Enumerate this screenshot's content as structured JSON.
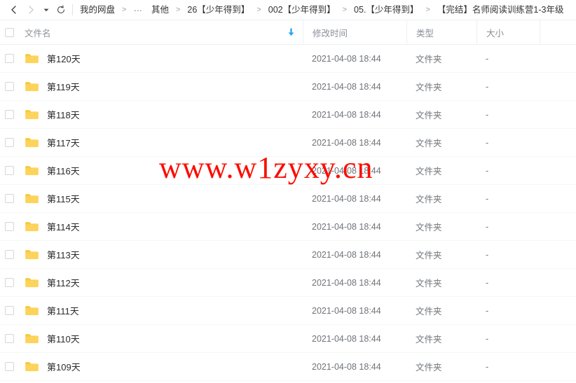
{
  "toolbar": {
    "back_label": "back-arrow",
    "forward_label": "forward-arrow",
    "caret_label": "history-dropdown",
    "refresh_label": "refresh"
  },
  "breadcrumb": {
    "separator": ">",
    "ellipsis": "…",
    "items": [
      "我的网盘",
      "…",
      "其他",
      "26【少年得到】",
      "002【少年得到】",
      "05.【少年得到】",
      "【完结】名师阅读训练营1-3年级"
    ]
  },
  "table": {
    "columns": [
      "文件名",
      "修改时间",
      "类型",
      "大小"
    ],
    "sort": {
      "column": "文件名",
      "direction": "desc",
      "icon": "arrow-down-icon",
      "color": "#2ca6f0"
    },
    "size_placeholder": "-",
    "rows": [
      {
        "name": "第120天",
        "modified": "2021-04-08 18:44",
        "type": "文件夹",
        "size": "-"
      },
      {
        "name": "第119天",
        "modified": "2021-04-08 18:44",
        "type": "文件夹",
        "size": "-"
      },
      {
        "name": "第118天",
        "modified": "2021-04-08 18:44",
        "type": "文件夹",
        "size": "-"
      },
      {
        "name": "第117天",
        "modified": "2021-04-08 18:44",
        "type": "文件夹",
        "size": "-"
      },
      {
        "name": "第116天",
        "modified": "2021-04-08 18:44",
        "type": "文件夹",
        "size": "-"
      },
      {
        "name": "第115天",
        "modified": "2021-04-08 18:44",
        "type": "文件夹",
        "size": "-"
      },
      {
        "name": "第114天",
        "modified": "2021-04-08 18:44",
        "type": "文件夹",
        "size": "-"
      },
      {
        "name": "第113天",
        "modified": "2021-04-08 18:44",
        "type": "文件夹",
        "size": "-"
      },
      {
        "name": "第112天",
        "modified": "2021-04-08 18:44",
        "type": "文件夹",
        "size": "-"
      },
      {
        "name": "第111天",
        "modified": "2021-04-08 18:44",
        "type": "文件夹",
        "size": "-"
      },
      {
        "name": "第110天",
        "modified": "2021-04-08 18:44",
        "type": "文件夹",
        "size": "-"
      },
      {
        "name": "第109天",
        "modified": "2021-04-08 18:44",
        "type": "文件夹",
        "size": "-"
      }
    ]
  },
  "watermark": {
    "text": "www.w1zyxy.cn",
    "color": "#fb0d00"
  },
  "colors": {
    "folder": "#fcd45c",
    "folder_tab": "#fbc93d",
    "accent": "#2ca6f0",
    "text": "#2b2b2b",
    "muted": "#6f7378",
    "header_text": "#8a9099",
    "border": "#eceff1"
  }
}
